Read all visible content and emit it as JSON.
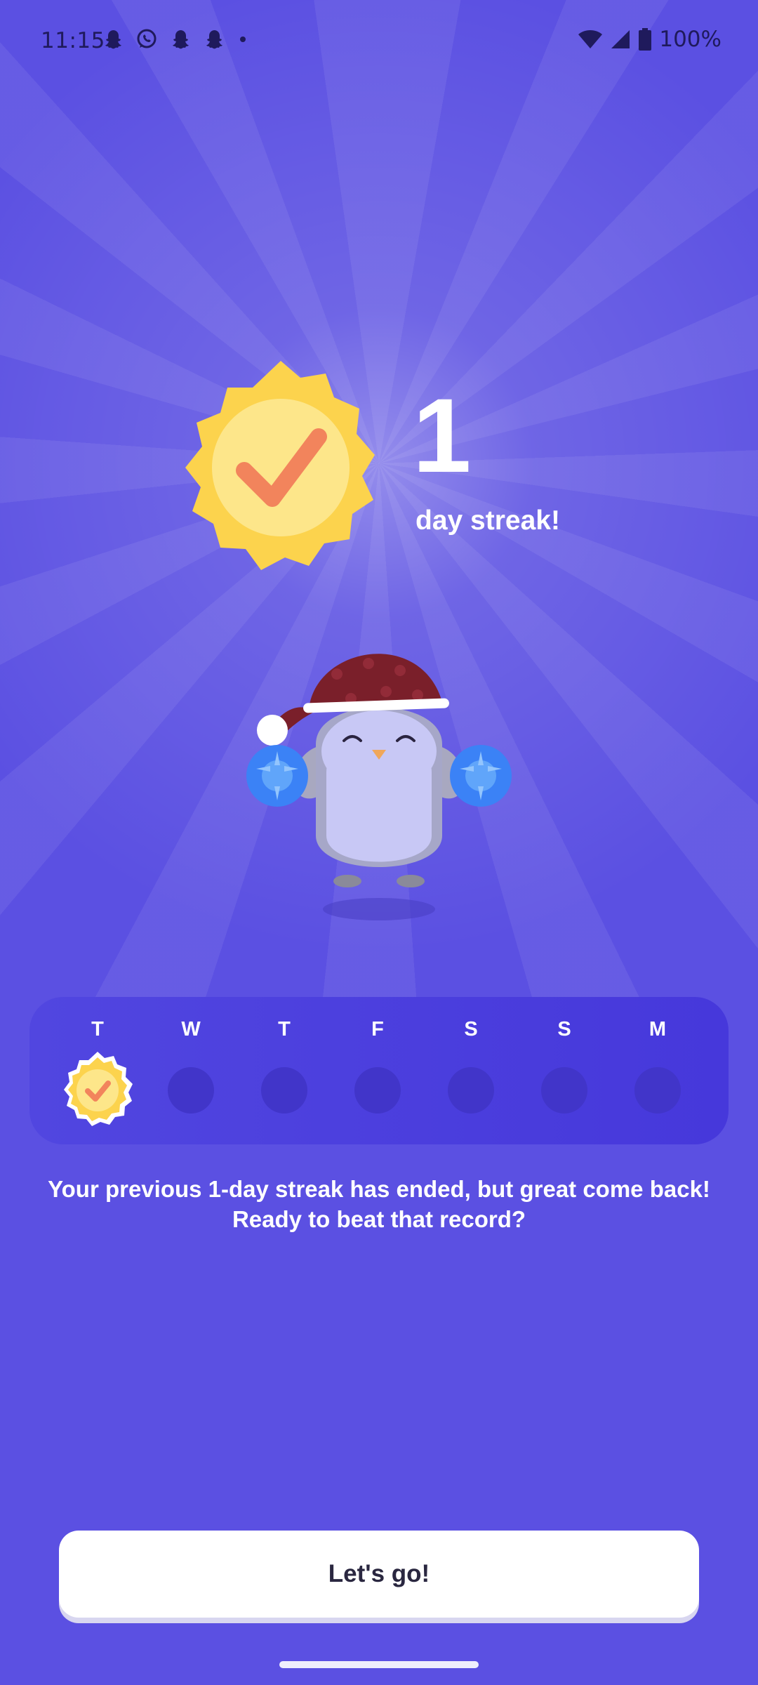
{
  "status_bar": {
    "time": "11:15",
    "notifications": [
      "snapchat-icon",
      "whatsapp-icon",
      "snapchat-icon",
      "snapchat-icon",
      "more-dot-icon"
    ],
    "battery": "100%"
  },
  "streak": {
    "count": "1",
    "label": "day streak!"
  },
  "week": {
    "days": [
      {
        "letter": "T",
        "completed": true
      },
      {
        "letter": "W",
        "completed": false
      },
      {
        "letter": "T",
        "completed": false
      },
      {
        "letter": "F",
        "completed": false
      },
      {
        "letter": "S",
        "completed": false
      },
      {
        "letter": "S",
        "completed": false
      },
      {
        "letter": "M",
        "completed": false
      }
    ]
  },
  "message": "Your previous 1-day streak has ended, but great come back! Ready to beat that record?",
  "cta": {
    "label": "Let's go!"
  },
  "colors": {
    "background": "#5b50e2",
    "badge_outer": "#fcd34d",
    "badge_inner": "#fde68a",
    "check": "#f2845c",
    "button": "#ffffff"
  }
}
